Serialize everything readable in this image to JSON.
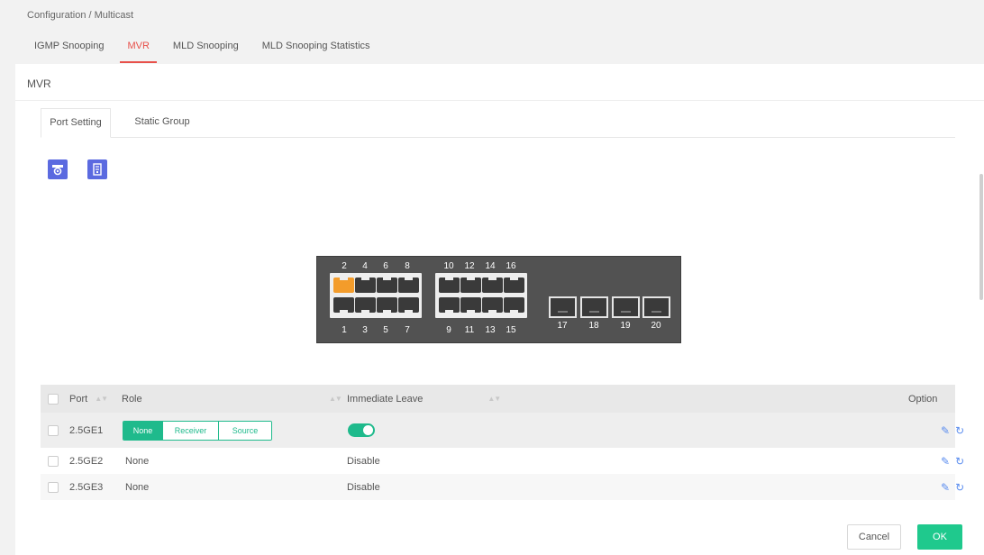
{
  "breadcrumb": "Configuration / Multicast",
  "tabs": [
    {
      "label": "IGMP Snooping"
    },
    {
      "label": "MVR"
    },
    {
      "label": "MLD Snooping"
    },
    {
      "label": "MLD Snooping Statistics"
    }
  ],
  "active_tab": "MVR",
  "panel_title": "MVR",
  "inner_tabs": [
    {
      "label": "Port Setting"
    },
    {
      "label": "Static Group"
    }
  ],
  "toolbar": {
    "icons": [
      "camera-icon",
      "document-icon"
    ],
    "color": "#5b6ae0"
  },
  "switch": {
    "top_numbers": [
      "2",
      "4",
      "6",
      "8",
      "10",
      "12",
      "14",
      "16"
    ],
    "bottom_numbers": [
      "1",
      "3",
      "5",
      "7",
      "9",
      "11",
      "13",
      "15"
    ],
    "sfp_numbers": [
      "17",
      "18",
      "19",
      "20"
    ],
    "highlighted_port": "2"
  },
  "table": {
    "columns": {
      "port": "Port",
      "role": "Role",
      "immediate_leave": "Immediate Leave",
      "option": "Option"
    },
    "role_options": [
      "None",
      "Receiver",
      "Source"
    ],
    "rows": [
      {
        "port": "2.5GE1",
        "role": "None",
        "immediate_leave": "Enabled",
        "editing": true
      },
      {
        "port": "2.5GE2",
        "role": "None",
        "immediate_leave": "Disable"
      },
      {
        "port": "2.5GE3",
        "role": "None",
        "immediate_leave": "Disable"
      }
    ]
  },
  "buttons": {
    "cancel": "Cancel",
    "ok": "OK"
  },
  "colors": {
    "accent_red": "#e8504a",
    "accent_green": "#1fba8c",
    "ok_green": "#1fc98d",
    "port_orange": "#f39c2b",
    "icon_blue": "#5b8def"
  }
}
